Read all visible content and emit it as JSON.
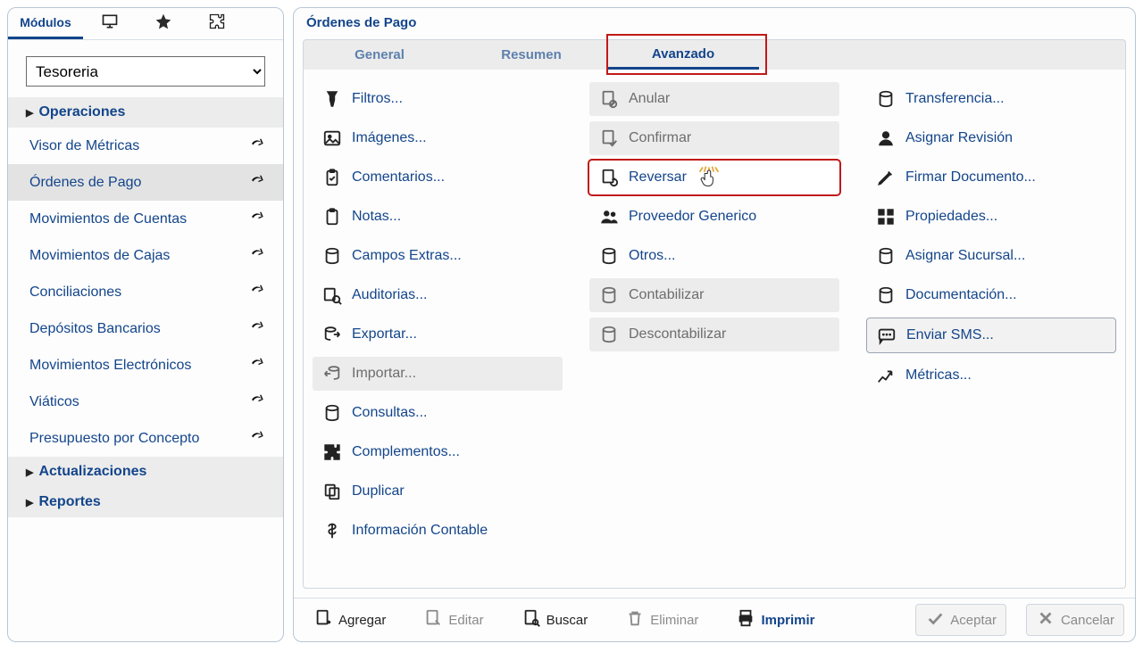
{
  "leftTabs": {
    "modules": "Módulos"
  },
  "moduleSelect": {
    "value": "Tesoreria"
  },
  "navGroups": {
    "operaciones": "Operaciones",
    "actualizaciones": "Actualizaciones",
    "reportes": "Reportes"
  },
  "navItems": [
    {
      "label": "Visor de Métricas"
    },
    {
      "label": "Órdenes de Pago"
    },
    {
      "label": "Movimientos de Cuentas"
    },
    {
      "label": "Movimientos de Cajas"
    },
    {
      "label": "Conciliaciones"
    },
    {
      "label": "Depósitos Bancarios"
    },
    {
      "label": "Movimientos Electrónicos"
    },
    {
      "label": "Viáticos"
    },
    {
      "label": "Presupuesto por Concepto"
    }
  ],
  "rightTitle": "Órdenes de Pago",
  "actionTabs": {
    "general": "General",
    "resumen": "Resumen",
    "avanzado": "Avanzado"
  },
  "col1": [
    {
      "label": "Filtros..."
    },
    {
      "label": "Imágenes..."
    },
    {
      "label": "Comentarios..."
    },
    {
      "label": "Notas..."
    },
    {
      "label": "Campos Extras..."
    },
    {
      "label": "Auditorias..."
    },
    {
      "label": "Exportar..."
    },
    {
      "label": "Importar..."
    },
    {
      "label": "Consultas..."
    },
    {
      "label": "Complementos..."
    },
    {
      "label": "Duplicar"
    },
    {
      "label": "Información Contable"
    }
  ],
  "col2": [
    {
      "label": "Anular"
    },
    {
      "label": "Confirmar"
    },
    {
      "label": "Reversar"
    },
    {
      "label": "Proveedor Generico"
    },
    {
      "label": "Otros..."
    },
    {
      "label": "Contabilizar"
    },
    {
      "label": "Descontabilizar"
    }
  ],
  "col3": [
    {
      "label": "Transferencia..."
    },
    {
      "label": "Asignar Revisión"
    },
    {
      "label": "Firmar Documento..."
    },
    {
      "label": "Propiedades..."
    },
    {
      "label": "Asignar Sucursal..."
    },
    {
      "label": "Documentación..."
    },
    {
      "label": "Enviar SMS..."
    },
    {
      "label": "Métricas..."
    }
  ],
  "footer": {
    "agregar": "Agregar",
    "editar": "Editar",
    "buscar": "Buscar",
    "eliminar": "Eliminar",
    "imprimir": "Imprimir",
    "aceptar": "Aceptar",
    "cancelar": "Cancelar"
  }
}
